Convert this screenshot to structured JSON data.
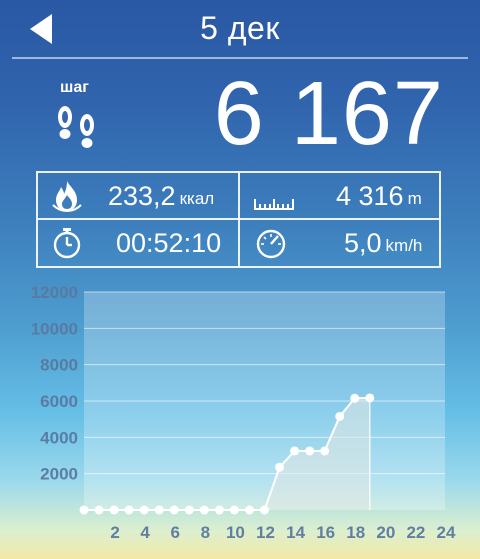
{
  "header": {
    "title": "5 дек",
    "back_icon": "back-arrow-icon"
  },
  "steps": {
    "label": "шаг",
    "value": "6 167",
    "icon": "footsteps-icon"
  },
  "stats": {
    "calories": {
      "value": "233,2",
      "unit": "ккал",
      "icon": "flame-icon"
    },
    "distance": {
      "value": "4 316",
      "unit": "m",
      "icon": "ruler-icon"
    },
    "time": {
      "value": "00:52:10",
      "icon": "stopwatch-icon"
    },
    "speed": {
      "value": "5,0",
      "unit": "km/h",
      "icon": "speedometer-icon"
    }
  },
  "chart_data": {
    "type": "line",
    "title": "",
    "xlabel": "",
    "ylabel": "",
    "x_ticks": [
      "2",
      "4",
      "6",
      "8",
      "10",
      "12",
      "14",
      "16",
      "18",
      "20",
      "22",
      "24"
    ],
    "y_ticks": [
      "12000",
      "10000",
      "8000",
      "6000",
      "4000",
      "2000"
    ],
    "xlim": [
      0,
      24
    ],
    "ylim": [
      0,
      12000
    ],
    "grid": true,
    "series": [
      {
        "x": [
          0,
          1,
          2,
          3,
          4,
          5,
          6,
          7,
          8,
          9,
          10,
          11,
          12,
          13,
          14,
          15,
          16,
          17,
          18,
          19
        ],
        "values": [
          0,
          0,
          0,
          0,
          0,
          0,
          0,
          0,
          0,
          0,
          0,
          0,
          0,
          2350,
          3250,
          3250,
          3250,
          5150,
          6150,
          6167
        ]
      }
    ],
    "colors": {
      "line": "#ffffff",
      "fill": "#e8ece8"
    }
  }
}
